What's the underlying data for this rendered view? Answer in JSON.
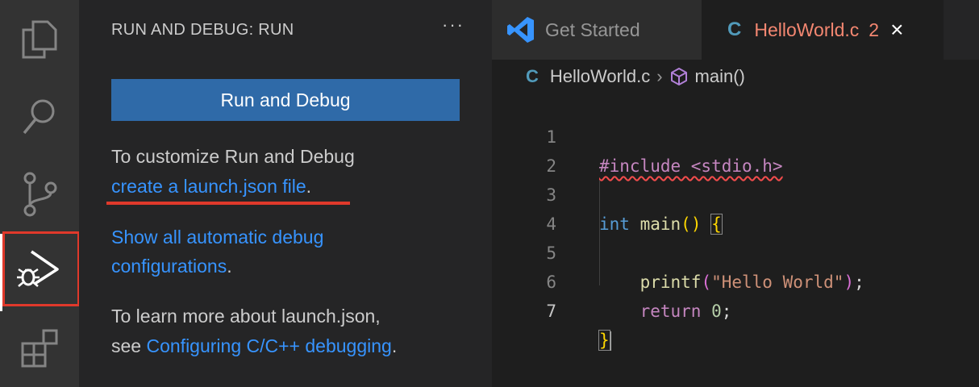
{
  "activity_bar": {
    "items": [
      {
        "name": "explorer",
        "icon": "files-icon"
      },
      {
        "name": "search",
        "icon": "search-icon"
      },
      {
        "name": "source-control",
        "icon": "source-control-icon"
      },
      {
        "name": "run-and-debug",
        "icon": "run-debug-icon",
        "active": true,
        "highlighted": true
      },
      {
        "name": "extensions",
        "icon": "extensions-icon"
      }
    ]
  },
  "sidebar": {
    "title": "RUN AND DEBUG: RUN",
    "more_label": "···",
    "run_button": "Run and Debug",
    "customize_text": "To customize Run and Debug",
    "create_link": "create a launch.json file",
    "create_suffix": ".",
    "show_link_line1": "Show all automatic debug",
    "show_link_line2": "configurations",
    "show_suffix": ".",
    "learn_line1": "To learn more about launch.json,",
    "learn_prefix": "see ",
    "learn_link": "Configuring C/C++ debugging",
    "learn_suffix": "."
  },
  "tabs": [
    {
      "label": "Get Started",
      "icon": "vscode-logo-icon",
      "active": false
    },
    {
      "label": "HelloWorld.c",
      "icon_letter": "C",
      "problems": "2",
      "close": "×",
      "active": true
    }
  ],
  "breadcrumb": {
    "icon_letter": "C",
    "file": "HelloWorld.c",
    "separator": "›",
    "symbol_icon": "cube-icon",
    "symbol": "main()"
  },
  "code": {
    "lines": [
      {
        "num": "1",
        "text": "#include <stdio.h>"
      },
      {
        "num": "2",
        "text": ""
      },
      {
        "num": "3",
        "text": "int main() {"
      },
      {
        "num": "4",
        "text": ""
      },
      {
        "num": "5",
        "text": "    printf(\"Hello World\");"
      },
      {
        "num": "6",
        "text": "    return 0;"
      },
      {
        "num": "7",
        "text": "}"
      }
    ]
  },
  "colors": {
    "link": "#3794ff",
    "highlight": "#e0392b",
    "button": "#2f6aa8",
    "error": "#f48771"
  }
}
